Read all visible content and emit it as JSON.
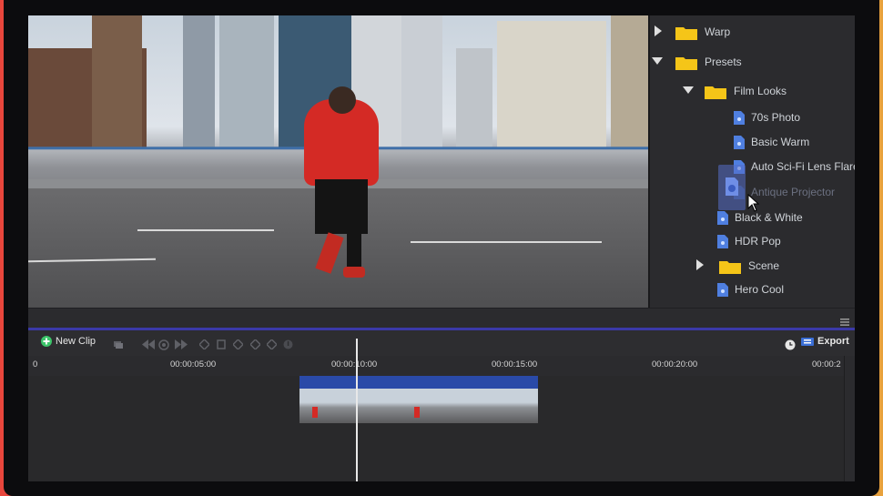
{
  "library": {
    "items": [
      {
        "label": "Warp",
        "type": "folder",
        "state": "collapsed"
      },
      {
        "label": "Presets",
        "type": "folder",
        "state": "expanded"
      },
      {
        "label": "Film Looks",
        "type": "folder",
        "state": "expanded"
      },
      {
        "label": "70s Photo",
        "type": "file"
      },
      {
        "label": "Basic Warm",
        "type": "file"
      },
      {
        "label": "Auto Sci-Fi Lens Flares",
        "type": "file"
      },
      {
        "label": "Antique Projector",
        "type": "file",
        "state": "dragging"
      },
      {
        "label": "Black & White",
        "type": "file"
      },
      {
        "label": "HDR Pop",
        "type": "file"
      },
      {
        "label": "Scene",
        "type": "folder",
        "state": "collapsed"
      },
      {
        "label": "Hero Cool",
        "type": "file"
      }
    ]
  },
  "toolbar": {
    "new_clip_label": "New Clip",
    "export_label": "Export",
    "icons": [
      "add-icon",
      "layers-icon",
      "rewind-icon",
      "play-icon",
      "forward-icon",
      "keyframe-icon",
      "stop-icon",
      "keyframe-icon",
      "keyframe-icon",
      "keyframe-icon",
      "info-icon",
      "clock-icon",
      "export-icon"
    ]
  },
  "ruler": {
    "labels": [
      "0",
      "00:00:05:00",
      "00:00:10:00",
      "00:00:15:00",
      "00:00:20:00",
      "00:00:2"
    ]
  },
  "colors": {
    "accent": "#3b39a8",
    "clip_header": "#2a4aa8",
    "folder": "#f5c518",
    "file": "#4f7fe0",
    "new_clip": "#3cc46a"
  }
}
